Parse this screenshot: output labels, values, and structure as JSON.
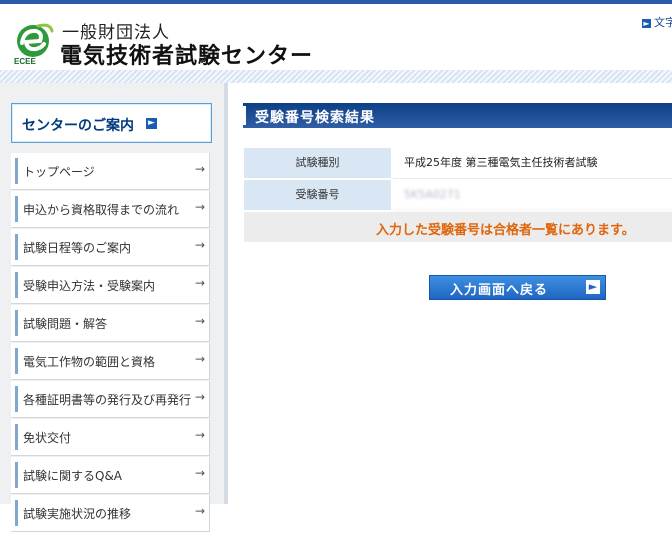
{
  "header": {
    "org_type": "一般財団法人",
    "org_name": "電気技術者試験センター",
    "logo_text": "ECEE",
    "top_link": "文字",
    "colors": {
      "brand_green": "#2e9a3c",
      "brand_blue": "#1a4b99"
    }
  },
  "sidebar": {
    "center_guide": "センターのご案内",
    "items": [
      {
        "label": "トップページ"
      },
      {
        "label": "申込から資格取得までの流れ"
      },
      {
        "label": "試験日程等のご案内"
      },
      {
        "label": "受験申込方法・受験案内"
      },
      {
        "label": "試験問題・解答"
      },
      {
        "label": "電気工作物の範囲と資格"
      },
      {
        "label": "各種証明書等の発行及び再発行"
      },
      {
        "label": "免状交付"
      },
      {
        "label": "試験に関するQ&A"
      },
      {
        "label": "試験実施状況の推移"
      }
    ]
  },
  "result": {
    "title": "受験番号検索結果",
    "rows": [
      {
        "label": "試験種別",
        "value": "平成25年度 第三種電気主任技術者試験"
      },
      {
        "label": "受験番号",
        "value": "5K5A0271"
      }
    ],
    "notice": "入力した受験番号は合格者一覧にあります。",
    "back_button": "入力画面へ戻る",
    "colors": {
      "title_bg": "#0d3f86",
      "notice_text": "#e0650c",
      "button_bg": "#2a7ad6"
    }
  }
}
